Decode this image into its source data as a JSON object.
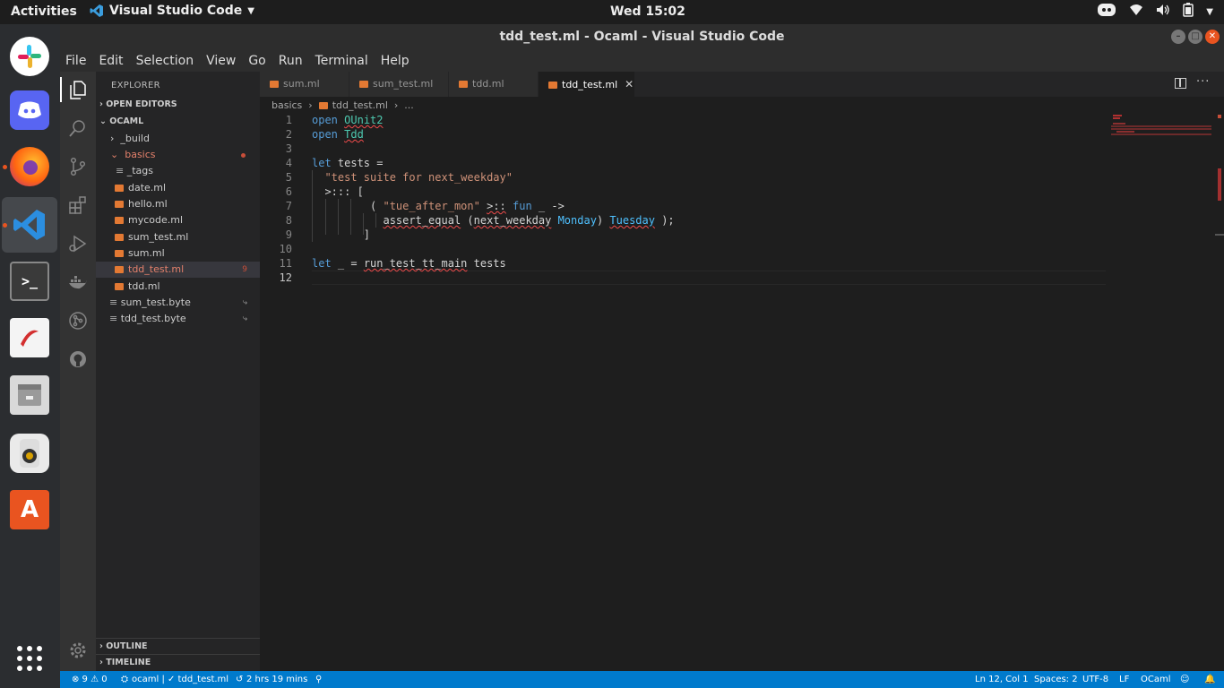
{
  "topbar": {
    "activities": "Activities",
    "app_name": "Visual Studio Code",
    "clock": "Wed 15:02"
  },
  "dock": {
    "items": [
      {
        "name": "slack-icon"
      },
      {
        "name": "discord-icon"
      },
      {
        "name": "firefox-icon"
      },
      {
        "name": "vscode-icon"
      },
      {
        "name": "terminal-icon"
      },
      {
        "name": "document-viewer-icon"
      },
      {
        "name": "file-manager-icon"
      },
      {
        "name": "music-player-icon"
      },
      {
        "name": "software-center-icon"
      },
      {
        "name": "show-applications-icon"
      }
    ]
  },
  "window": {
    "title": "tdd_test.ml - Ocaml - Visual Studio Code"
  },
  "menubar": {
    "items": [
      "File",
      "Edit",
      "Selection",
      "View",
      "Go",
      "Run",
      "Terminal",
      "Help"
    ]
  },
  "sidebar": {
    "header": "EXPLORER",
    "open_editors": "OPEN EDITORS",
    "workspace": "OCAML",
    "tree": [
      {
        "label": "_build"
      },
      {
        "label": "basics"
      },
      {
        "label": "_tags"
      },
      {
        "label": "date.ml"
      },
      {
        "label": "hello.ml"
      },
      {
        "label": "mycode.ml"
      },
      {
        "label": "sum_test.ml"
      },
      {
        "label": "sum.ml"
      },
      {
        "label": "tdd_test.ml",
        "badge": "9"
      },
      {
        "label": "tdd.ml"
      },
      {
        "label": "sum_test.byte"
      },
      {
        "label": "tdd_test.byte"
      }
    ],
    "outline": "OUTLINE",
    "timeline": "TIMELINE"
  },
  "tabs": [
    {
      "label": "sum.ml"
    },
    {
      "label": "sum_test.ml"
    },
    {
      "label": "tdd.ml"
    },
    {
      "label": "tdd_test.ml"
    }
  ],
  "breadcrumb": {
    "folder": "basics",
    "file": "tdd_test.ml",
    "more": "..."
  },
  "editor": {
    "line_numbers": [
      "1",
      "2",
      "3",
      "4",
      "5",
      "6",
      "7",
      "8",
      "9",
      "10",
      "11",
      "12"
    ]
  },
  "statusbar": {
    "problems": "⊗ 9 ⚠ 0",
    "branch": "ocaml | ✓ tdd_test.ml",
    "time": "2 hrs 19 mins",
    "position": "Ln 12, Col 1",
    "spaces": "Spaces: 2",
    "encoding": "UTF-8",
    "eol": "LF",
    "language": "OCaml"
  }
}
